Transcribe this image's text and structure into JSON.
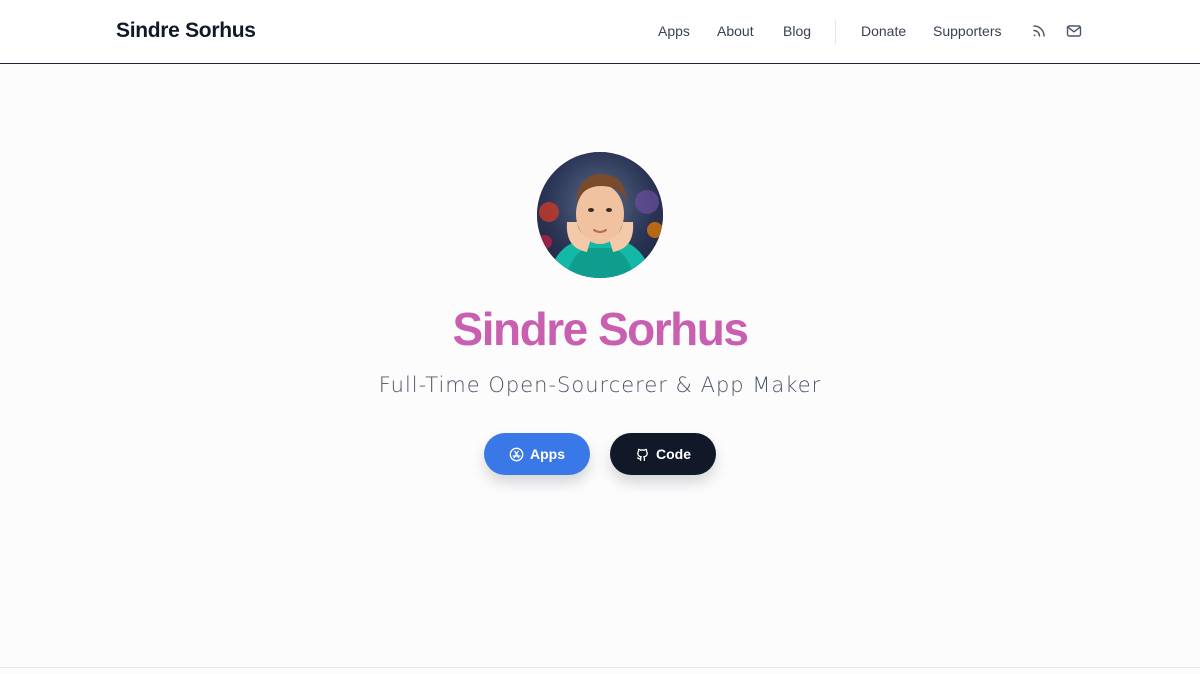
{
  "header": {
    "brand": "Sindre Sorhus",
    "nav": [
      {
        "label": "Apps"
      },
      {
        "label": "About"
      },
      {
        "label": "Blog"
      },
      {
        "label": "Donate"
      },
      {
        "label": "Supporters"
      }
    ],
    "icons": [
      "rss-icon",
      "mail-icon"
    ]
  },
  "hero": {
    "name": "Sindre Sorhus",
    "tagline": "Full-Time Open-Sourcerer & App Maker",
    "buttons": [
      {
        "label": "Apps",
        "icon": "app-store-icon"
      },
      {
        "label": "Code",
        "icon": "github-icon"
      }
    ]
  },
  "colors": {
    "name": "#c85fb0",
    "apps_button": "#3b78e7",
    "code_button": "#111827"
  }
}
